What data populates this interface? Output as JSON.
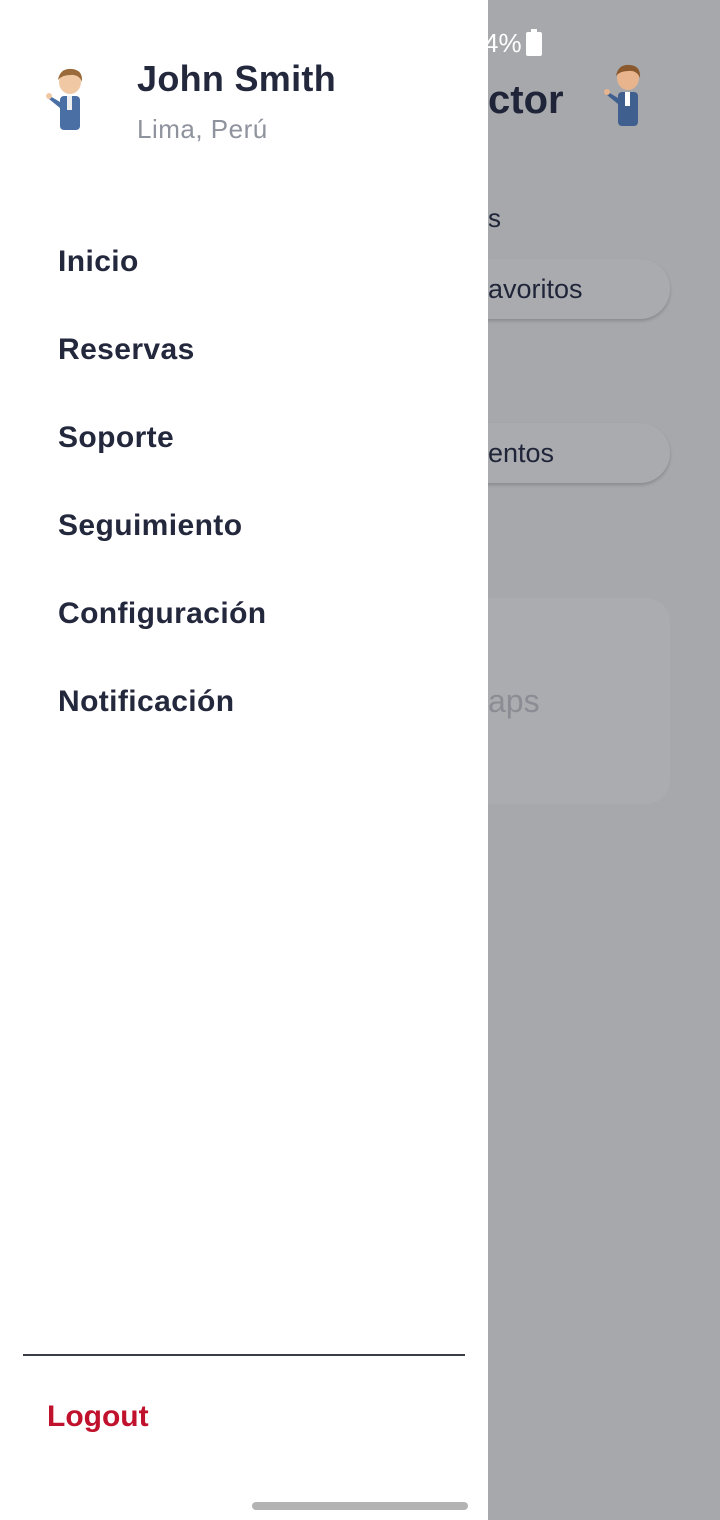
{
  "background": {
    "status_text": "4%",
    "title_partial": "ctor",
    "section_label_partial": "s",
    "pill_1_partial": "avoritos",
    "pill_2_partial": "entos",
    "card_partial": "aps",
    "colors": {
      "overlay": "#a6a8ac",
      "title": "#1f2438"
    }
  },
  "drawer": {
    "user": {
      "name": "John Smith",
      "location": "Lima, Perú",
      "avatar_icon": "person-avatar-icon"
    },
    "menu": [
      {
        "label": "Inicio"
      },
      {
        "label": "Reservas"
      },
      {
        "label": "Soporte"
      },
      {
        "label": "Seguimiento"
      },
      {
        "label": "Configuración"
      },
      {
        "label": "Notificación"
      }
    ],
    "logout_label": "Logout",
    "colors": {
      "text": "#23283d",
      "muted": "#8e939d",
      "logout": "#c0122c"
    }
  }
}
